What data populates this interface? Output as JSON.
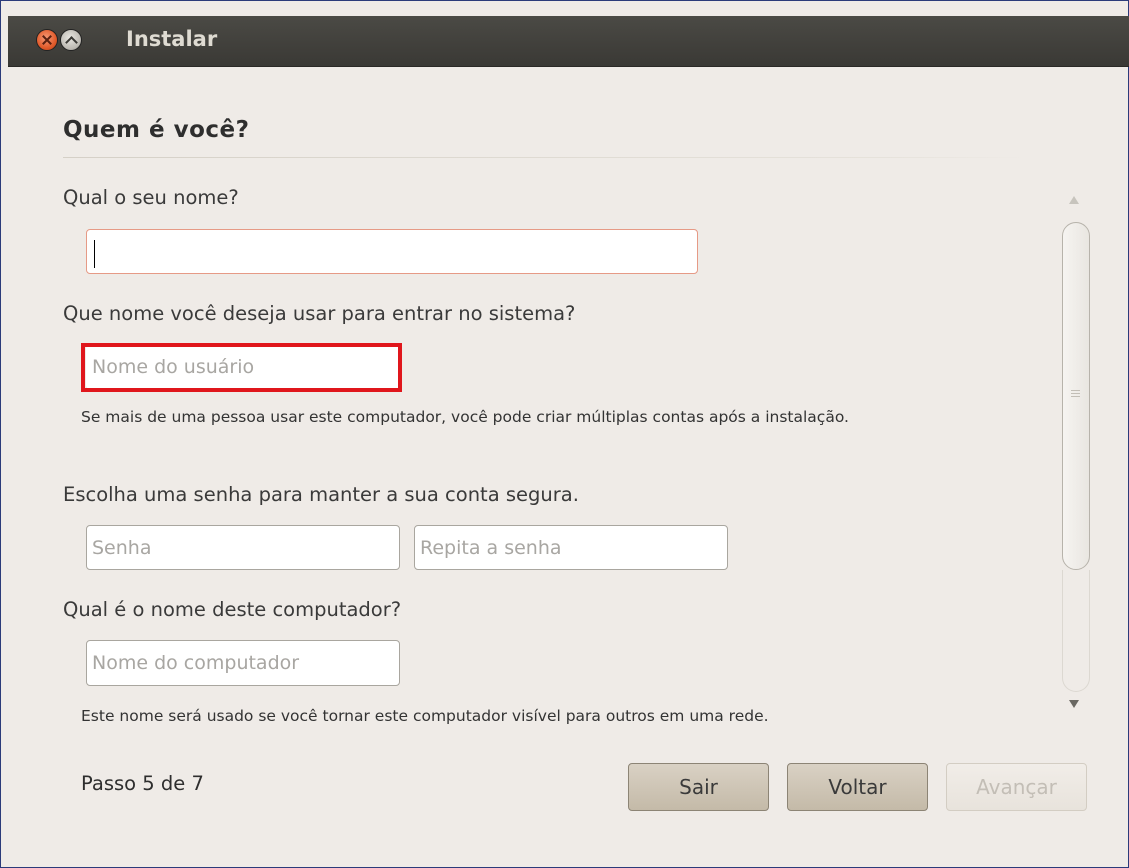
{
  "window": {
    "title": "Instalar"
  },
  "page": {
    "heading": "Quem é você?"
  },
  "form": {
    "name_label": "Qual o seu nome?",
    "name_value": "",
    "username_label": "Que nome você deseja usar para entrar no sistema?",
    "username_placeholder": "Nome do usuário",
    "multi_account_note": "Se mais de uma pessoa usar este computador, você pode criar múltiplas contas após a instalação.",
    "password_label": "Escolha uma senha para manter a sua conta segura.",
    "password_placeholder": "Senha",
    "password_repeat_placeholder": "Repita a senha",
    "computer_label": "Qual é o nome deste computador?",
    "computer_placeholder": "Nome do computador",
    "computer_note": "Este nome será usado se você tornar este computador visível para outros em uma rede."
  },
  "footer": {
    "step_text": "Passo 5 de 7",
    "quit_label": "Sair",
    "back_label": "Voltar",
    "forward_label": "Avançar"
  },
  "colors": {
    "highlight": "#e0161c",
    "titlebar": "#3f3e3a",
    "background": "#efebe7"
  }
}
